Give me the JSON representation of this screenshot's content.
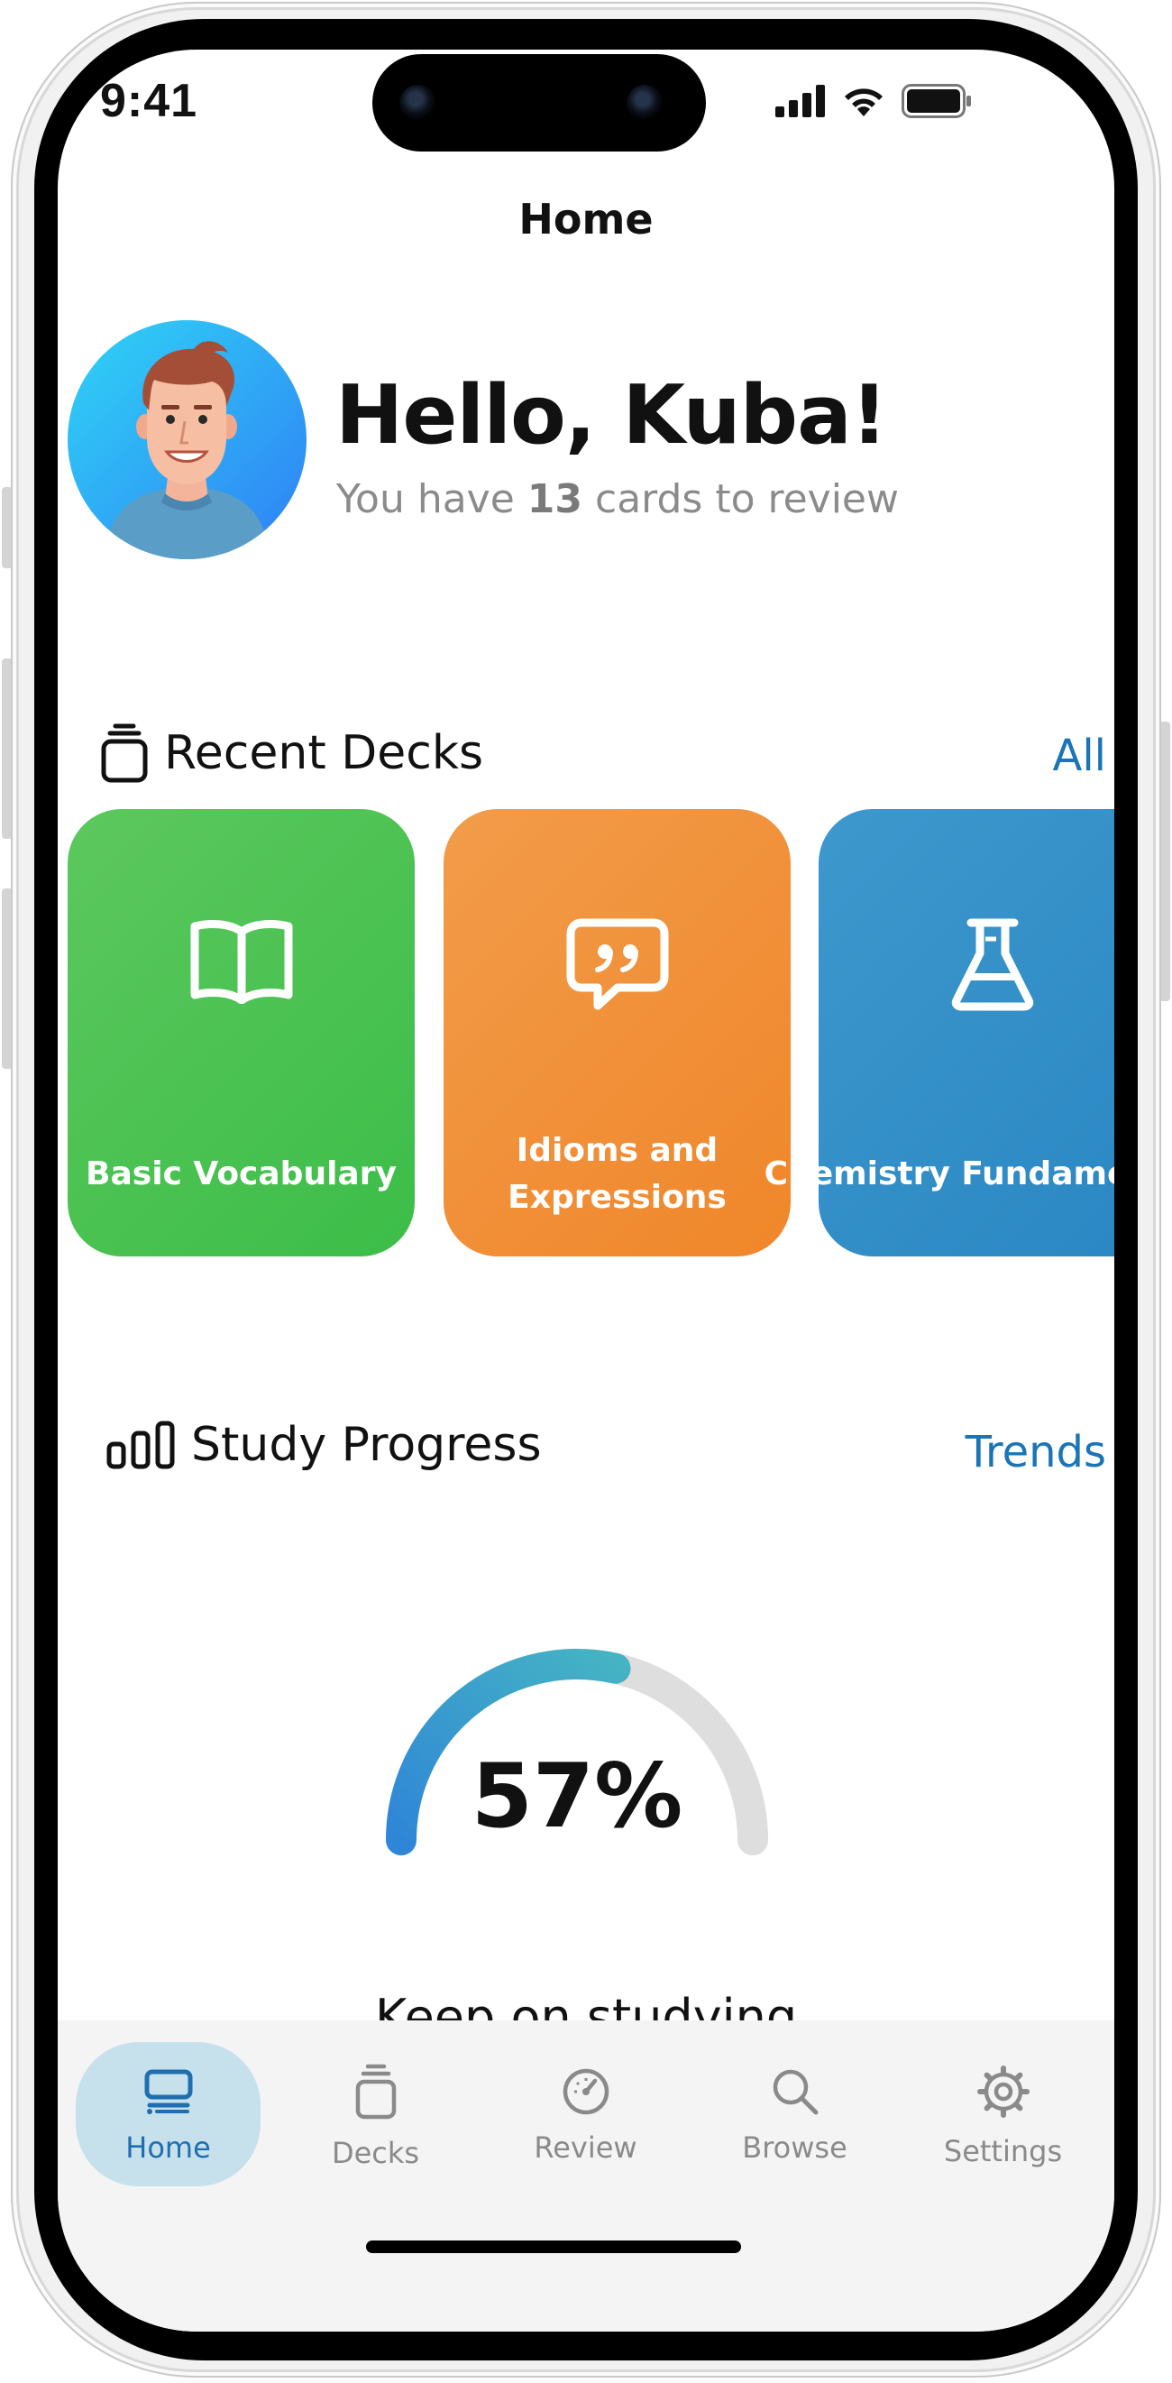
{
  "status_bar": {
    "time": "9:41"
  },
  "header": {
    "title": "Home"
  },
  "profile": {
    "greeting": "Hello, Kuba!",
    "review_prefix": "You have ",
    "review_count": "13",
    "review_suffix": " cards to review"
  },
  "recent_decks": {
    "title": "Recent Decks",
    "link": "All",
    "items": [
      {
        "name": "Basic Vocabulary",
        "icon": "book-open-icon",
        "color": "#45c151"
      },
      {
        "name": "Idioms and Expressions",
        "icon": "quote-bubble-icon",
        "color": "#f18d35"
      },
      {
        "name": "Chemistry Fundamentals",
        "icon": "flask-icon",
        "color": "#318cc6"
      }
    ]
  },
  "study_progress": {
    "title": "Study Progress",
    "link": "Trends",
    "percent_label": "57%",
    "progress": 0.57,
    "message": "Keep on studying"
  },
  "tab_bar": {
    "items": [
      {
        "label": "Home",
        "icon": "home-icon",
        "active": true
      },
      {
        "label": "Decks",
        "icon": "decks-icon",
        "active": false
      },
      {
        "label": "Review",
        "icon": "gauge-icon",
        "active": false
      },
      {
        "label": "Browse",
        "icon": "search-icon",
        "active": false
      },
      {
        "label": "Settings",
        "icon": "gear-icon",
        "active": false
      }
    ]
  },
  "colors": {
    "accent": "#1b74b6",
    "tab_active_bg": "#c6e0ec",
    "gauge_start": "#2f86d6",
    "gauge_end": "#45b3c4",
    "gauge_track": "#dedede"
  }
}
